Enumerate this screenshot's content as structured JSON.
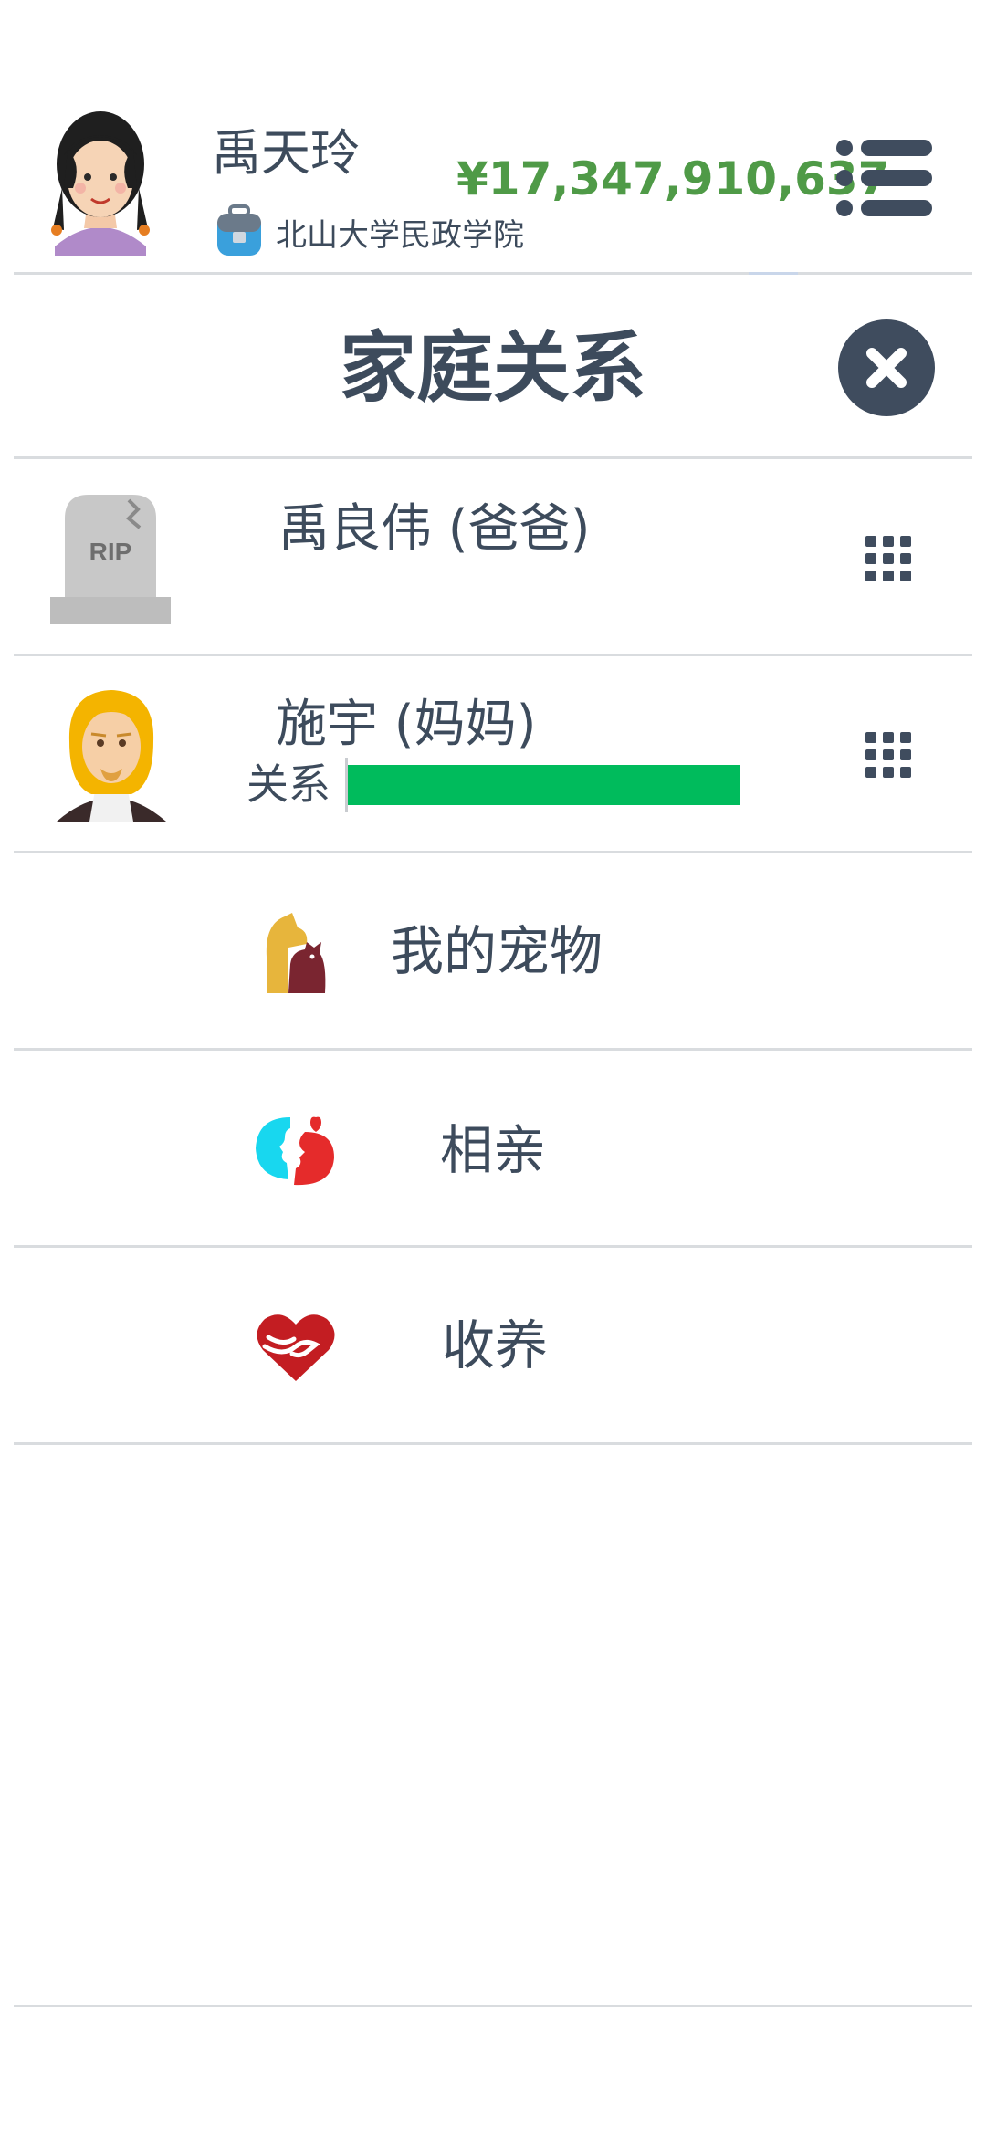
{
  "header": {
    "player_name": "禹天玲",
    "school_name": "北山大学民政学院",
    "money": "¥17,347,910,637"
  },
  "page": {
    "title": "家庭关系"
  },
  "family": [
    {
      "name": "禹良伟 (爸爸)",
      "status": "deceased",
      "tombstone_text": "RIP"
    },
    {
      "name": "施宇 (妈妈)",
      "relation_label": "关系",
      "relation_level": 1.0
    }
  ],
  "menu": [
    {
      "label": "我的宠物",
      "icon": "pet-icon"
    },
    {
      "label": "相亲",
      "icon": "dating-icon"
    },
    {
      "label": "收养",
      "icon": "adopt-heart-icon"
    }
  ],
  "colors": {
    "text": "#3d4b5c",
    "money": "#4f9a47",
    "relation_bar": "#00bb5c",
    "close_button": "#3f4c5e"
  }
}
